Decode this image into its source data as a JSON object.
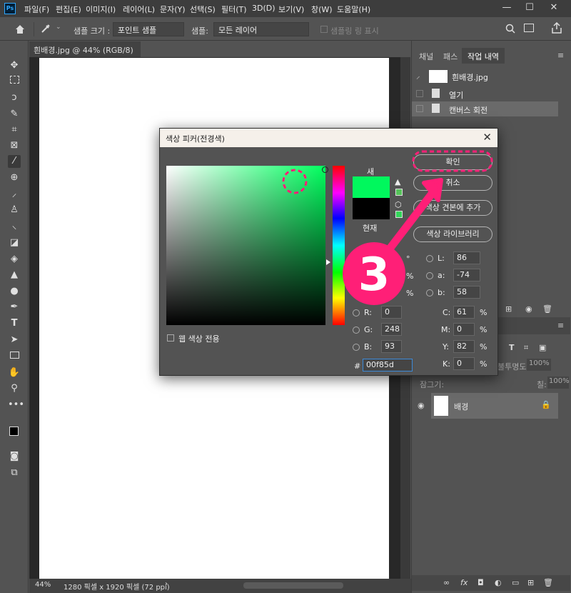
{
  "app": {
    "logo": "Ps",
    "menu": [
      "파일(F)",
      "편집(E)",
      "이미지(I)",
      "레이어(L)",
      "문자(Y)",
      "선택(S)",
      "필터(T)",
      "3D(D)",
      "보기(V)",
      "창(W)",
      "도움말(H)"
    ],
    "window_controls": [
      "—",
      "☐",
      "✕"
    ]
  },
  "options_bar": {
    "sample_size_label": "샘플 크기 :",
    "sample_size_value": "포인트 샘플",
    "sample_label": "샘플:",
    "sample_value": "모든 레이어",
    "show_sampling_ring": "샘플링 링 표시"
  },
  "document": {
    "tab_title": "흰배경.jpg @ 44% (RGB/8) *",
    "tab_close": "×",
    "zoom": "44%",
    "status": "1280 픽셀 x 1920 픽셀 (72 ppi)",
    "status_arrow": "›"
  },
  "right_panel": {
    "tabs": [
      "채널",
      "패스",
      "작업 내역"
    ],
    "active_tab": "작업 내역",
    "history_snapshot": "흰배경.jpg",
    "history_items": [
      "열기",
      "캔버스 회전"
    ],
    "layers": {
      "opacity_label": "불투명도:",
      "opacity_value": "100%",
      "lock_label": "잠그기:",
      "fill_label": "칠:",
      "fill_value": "100%",
      "layer_name": "배경"
    }
  },
  "color_picker": {
    "title": "색상 피커(전경색)",
    "close": "✕",
    "new_label": "새",
    "current_label": "현재",
    "new_color": "#00f85d",
    "current_color": "#000000",
    "buttons": {
      "ok": "확인",
      "cancel": "취소",
      "add_swatch": "색상 견본에 추가",
      "libraries": "색상 라이브러리"
    },
    "web_colors_only": "웹 색상 전용",
    "hsb": {
      "h_unit": "°",
      "s_unit": "%",
      "b_unit": "%"
    },
    "rgb": {
      "r_label": "R:",
      "r": "0",
      "g_label": "G:",
      "g": "248",
      "b_label": "B:",
      "b": "93"
    },
    "lab": {
      "l_label": "L:",
      "l": "86",
      "a_label": "a:",
      "a": "-74",
      "b_label": "b:",
      "b": "58"
    },
    "cmyk": {
      "c_label": "C:",
      "c": "61",
      "m_label": "M:",
      "m": "0",
      "y_label": "Y:",
      "y": "82",
      "k_label": "K:",
      "k": "0",
      "unit": "%"
    },
    "hex_label": "#",
    "hex": "00f85d"
  },
  "annotation": {
    "step_number": "3",
    "accent_color": "#ff1f77"
  }
}
